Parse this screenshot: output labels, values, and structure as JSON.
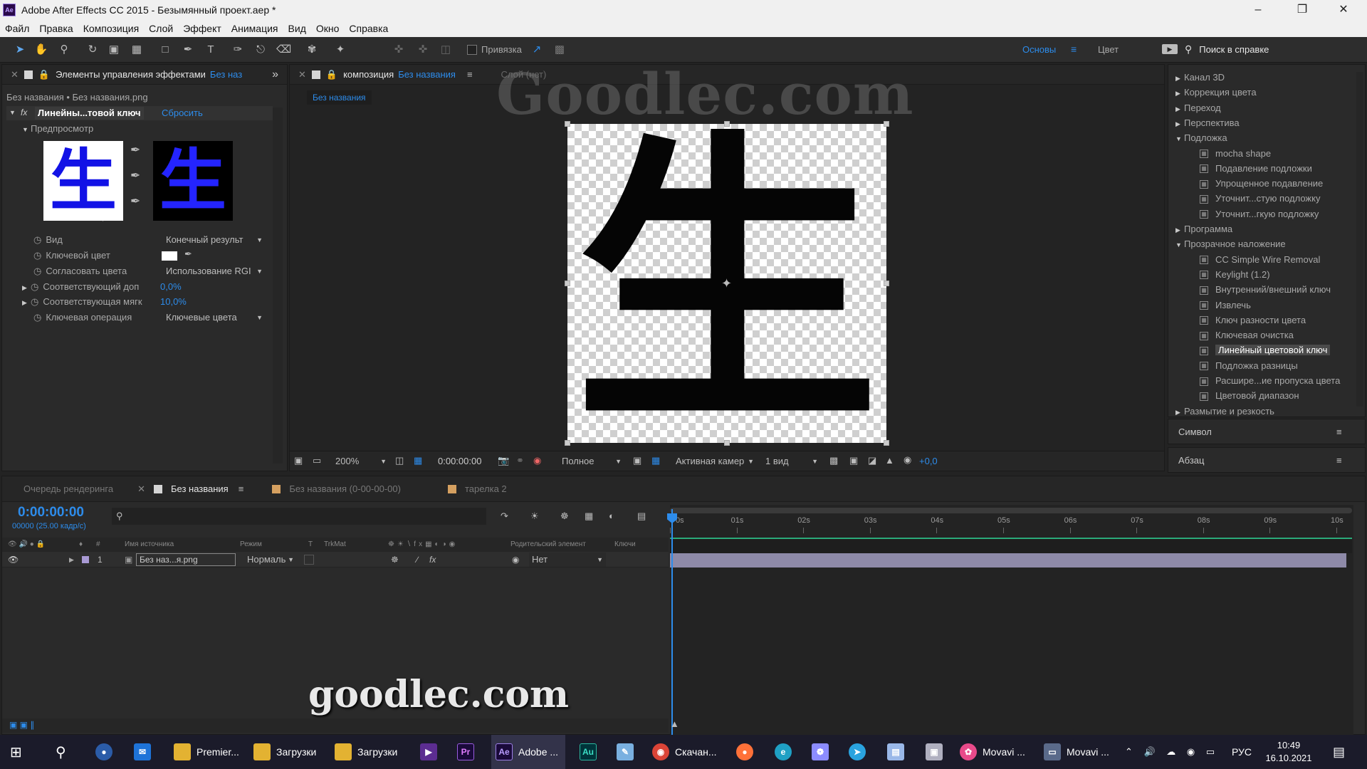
{
  "window": {
    "title": "Adobe After Effects CC 2015 - Безымянный проект.aep *"
  },
  "menu": [
    "Файл",
    "Правка",
    "Композиция",
    "Слой",
    "Эффект",
    "Анимация",
    "Вид",
    "Окно",
    "Справка"
  ],
  "toolbar": {
    "snap_label": "Привязка",
    "workspace_active": "Основы",
    "workspace_other": "Цвет",
    "help_search_placeholder": "Поиск в справке"
  },
  "watermark_top": "Goodlec.com",
  "watermark_bottom": "goodlec.com",
  "effect_controls": {
    "tab_label": "Элементы управления эффектами",
    "tab_suffix": "Без наз",
    "breadcrumb": "Без названия • Без названия.png",
    "effect_name": "Линейны...товой ключ",
    "reset_label": "Сбросить",
    "preview_label": "Предпросмотр",
    "preview_glyph": "生",
    "properties": [
      {
        "label": "Вид",
        "value": "Конечный результ"
      },
      {
        "label": "Ключевой цвет",
        "value": ""
      },
      {
        "label": "Согласовать цвета",
        "value": "Использование RGI"
      },
      {
        "label": "Соответствующий доп",
        "value": "0,0%"
      },
      {
        "label": "Соответствующая мягк",
        "value": "10,0%"
      },
      {
        "label": "Ключевая операция",
        "value": "Ключевые цвета"
      }
    ]
  },
  "composition": {
    "tab_label": "композиция",
    "tab_name": "Без названия",
    "layer_tab": "Слой (нет)",
    "comp_chip": "Без названия",
    "glyph": "生",
    "footer": {
      "zoom": "200%",
      "timecode": "0:00:00:00",
      "quality": "Полное",
      "camera": "Активная камер",
      "views": "1 вид",
      "exposure": "+0,0"
    }
  },
  "effects_panel": {
    "items": [
      {
        "type": "folder",
        "label": "Канал 3D",
        "open": false
      },
      {
        "type": "folder",
        "label": "Коррекция цвета",
        "open": false
      },
      {
        "type": "folder",
        "label": "Переход",
        "open": false
      },
      {
        "type": "folder",
        "label": "Перспектива",
        "open": false
      },
      {
        "type": "folder",
        "label": "Подложка",
        "open": true
      },
      {
        "type": "effect",
        "label": "mocha shape"
      },
      {
        "type": "effect",
        "label": "Подавление подложки"
      },
      {
        "type": "effect",
        "label": "Упрощенное подавление"
      },
      {
        "type": "effect",
        "label": "Уточнит...стую подложку"
      },
      {
        "type": "effect",
        "label": "Уточнит...гкую подложку"
      },
      {
        "type": "folder",
        "label": "Программа",
        "open": false
      },
      {
        "type": "folder",
        "label": "Прозрачное наложение",
        "open": true
      },
      {
        "type": "effect",
        "label": "CC Simple Wire Removal"
      },
      {
        "type": "effect",
        "label": "Keylight (1.2)"
      },
      {
        "type": "effect",
        "label": "Внутренний/внешний ключ"
      },
      {
        "type": "effect",
        "label": "Извлечь"
      },
      {
        "type": "effect",
        "label": "Ключ разности цвета"
      },
      {
        "type": "effect",
        "label": "Ключевая очистка"
      },
      {
        "type": "effect",
        "label": "Линейный цветовой ключ",
        "selected": true
      },
      {
        "type": "effect",
        "label": "Подложка разницы"
      },
      {
        "type": "effect",
        "label": "Расшире...ие пропуска цвета"
      },
      {
        "type": "effect",
        "label": "Цветовой диапазон"
      },
      {
        "type": "folder",
        "label": "Размытие и резкость",
        "open": false
      }
    ],
    "symbol_panel": "Символ",
    "paragraph_panel": "Абзац"
  },
  "timeline": {
    "tabs": [
      "Очередь рендеринга",
      "Без названия",
      "Без названия (0-00-00-00)",
      "тарелка 2"
    ],
    "timecode": "0:00:00:00",
    "fps": "00000 (25.00 кадр/с)",
    "columns": [
      "#",
      "Имя источника",
      "Режим",
      "T",
      "TrkMat",
      "Родительский элемент",
      "Ключи"
    ],
    "layer": {
      "num": "1",
      "name": "Без наз...я.png",
      "mode": "Нормаль",
      "parent": "Нет"
    },
    "ruler": [
      "0s",
      "01s",
      "02s",
      "03s",
      "04s",
      "05s",
      "06s",
      "07s",
      "08s",
      "09s",
      "10s"
    ]
  },
  "taskbar": {
    "items": [
      "Premier...",
      "Загрузки",
      "Загрузки",
      "Adobe ...",
      "Скачан...",
      "Movavi ...",
      "Movavi ..."
    ],
    "lang": "РУС",
    "time": "10:49",
    "date": "16.10.2021"
  }
}
